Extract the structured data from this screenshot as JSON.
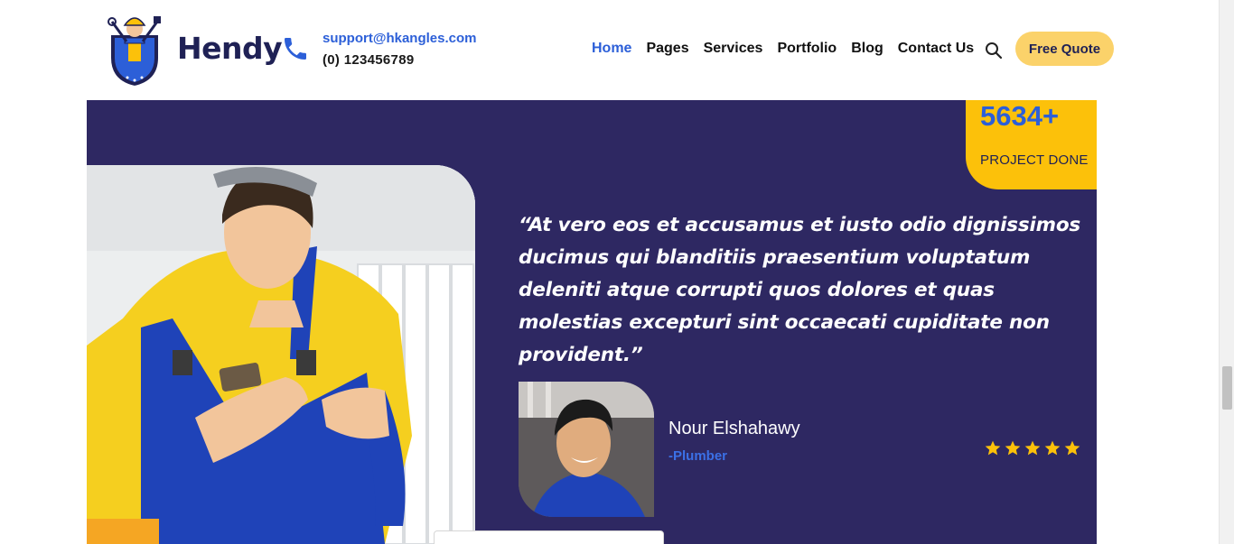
{
  "header": {
    "brand": "Hendy",
    "email": "support@hkangles.com",
    "phone": "(0) 123456789",
    "nav": [
      "Home",
      "Pages",
      "Services",
      "Portfolio",
      "Blog",
      "Contact Us"
    ],
    "active_nav": "Home",
    "quote_button": "Free Quote",
    "icons": {
      "logo": "handyman-logo",
      "phone": "phone-icon",
      "search": "search-icon"
    }
  },
  "stat": {
    "number": "5634+",
    "label": "PROJECT DONE"
  },
  "testimonial": {
    "quote": "“At vero eos et accusamus et iusto odio dignissimos ducimus qui blanditiis praesentium voluptatum deleniti atque corrupti quos dolores et quas molestias excepturi sint occaecati cupiditate non provident.”",
    "name": "Nour Elshahawy",
    "role": "-Plumber",
    "rating": 5,
    "rating_max": 5
  },
  "colors": {
    "section_bg": "#2e2862",
    "accent_blue": "#2c5fd8",
    "accent_yellow": "#fcc10a",
    "button_yellow": "#fbd26a",
    "star_color": "#fcc10a",
    "brand_navy": "#1f2155"
  }
}
